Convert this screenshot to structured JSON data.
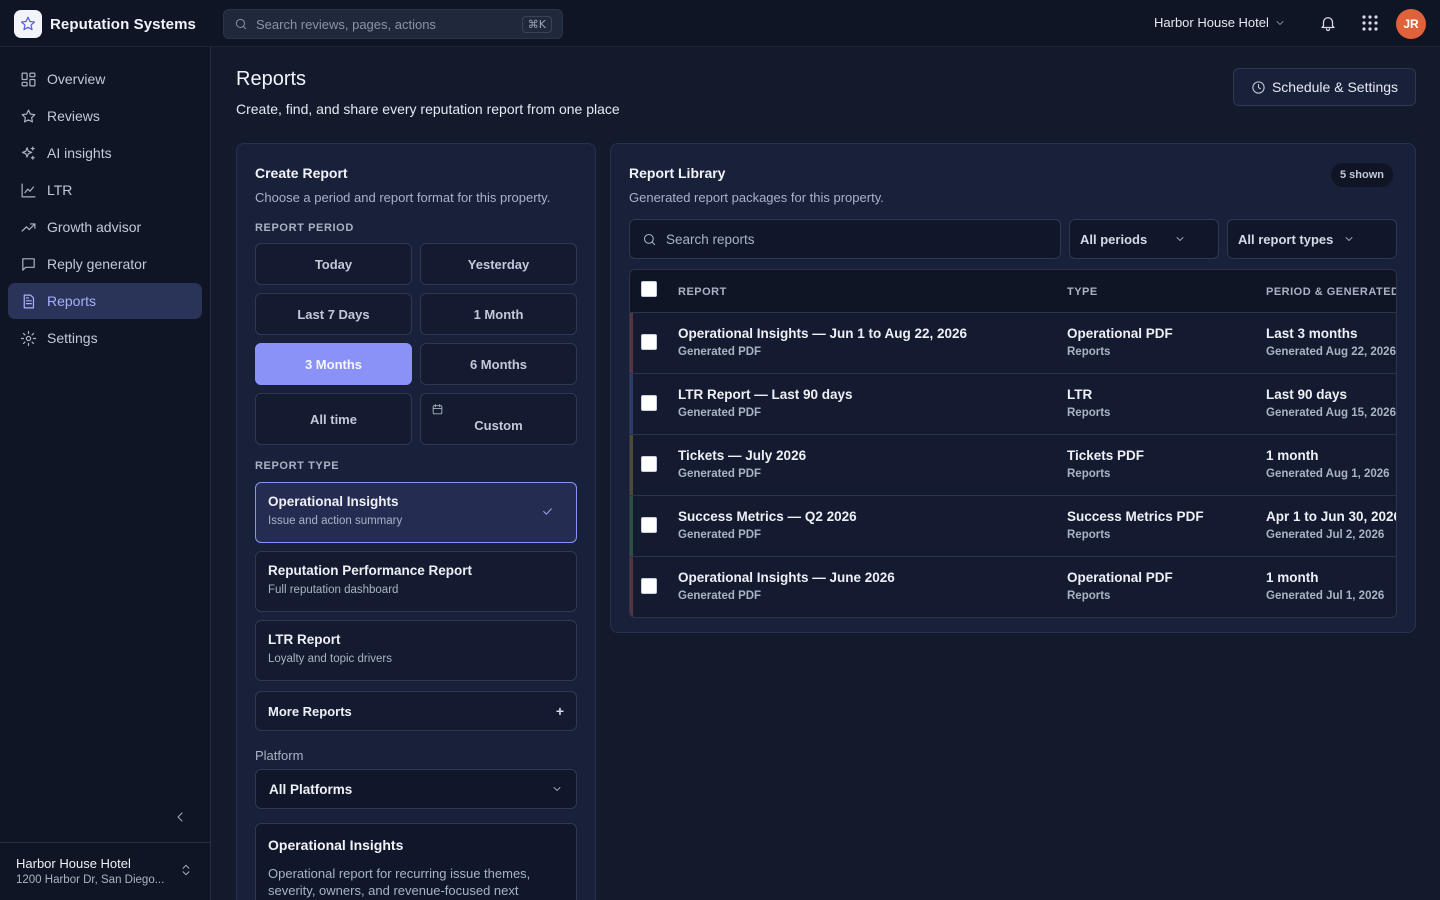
{
  "app": {
    "name": "Reputation Systems"
  },
  "topbar": {
    "search_placeholder": "Search reviews, pages, actions",
    "search_shortcut": "⌘K",
    "property": "Harbor House Hotel",
    "avatar_initials": "JR"
  },
  "sidebar": {
    "items": [
      {
        "label": "Overview",
        "icon": "grid-icon"
      },
      {
        "label": "Reviews",
        "icon": "star-icon"
      },
      {
        "label": "AI insights",
        "icon": "sparkles-icon"
      },
      {
        "label": "LTR",
        "icon": "line-chart-icon"
      },
      {
        "label": "Growth advisor",
        "icon": "trend-up-icon"
      },
      {
        "label": "Reply generator",
        "icon": "chat-icon"
      },
      {
        "label": "Reports",
        "icon": "document-icon",
        "active": true
      },
      {
        "label": "Settings",
        "icon": "gear-icon"
      }
    ],
    "footer": {
      "name": "Harbor House Hotel",
      "address": "1200 Harbor Dr, San Diego..."
    }
  },
  "header": {
    "title": "Reports",
    "subtitle": "Create, find, and share every reputation report from one place",
    "schedule_button": "Schedule & Settings"
  },
  "create": {
    "title": "Create Report",
    "subtitle": "Choose a period and report format for this property.",
    "period_label": "REPORT PERIOD",
    "periods": [
      "Today",
      "Yesterday",
      "Last 7 Days",
      "1 Month",
      "3 Months",
      "6 Months",
      "All time",
      "Custom"
    ],
    "selected_period": "3 Months",
    "type_label": "REPORT TYPE",
    "types": [
      {
        "name": "Operational Insights",
        "desc": "Issue and action summary",
        "selected": true
      },
      {
        "name": "Reputation Performance Report",
        "desc": "Full reputation dashboard"
      },
      {
        "name": "LTR Report",
        "desc": "Loyalty and topic drivers"
      }
    ],
    "more_reports": "More Reports",
    "more_reports_icon": "+",
    "platform_label": "Platform",
    "platform_value": "All Platforms",
    "summary": {
      "title": "Operational Insights",
      "body": "Operational report for recurring issue themes, severity, owners, and revenue-focused next"
    }
  },
  "library": {
    "title": "Report Library",
    "subtitle": "Generated report packages for this property.",
    "count": "5 shown",
    "search_placeholder": "Search reports",
    "filter_periods": "All periods",
    "filter_types": "All report types",
    "columns": [
      "REPORT",
      "TYPE",
      "PERIOD & GENERATED"
    ],
    "rows": [
      {
        "name": "Operational Insights — Jun 1 to Aug 22, 2026",
        "format": "Generated PDF",
        "type": "Operational PDF",
        "category": "Reports",
        "period": "Last 3 months",
        "generated": "Generated Aug 22, 2026",
        "accent": "#5a3342"
      },
      {
        "name": "LTR Report — Last 90 days",
        "format": "Generated PDF",
        "type": "LTR",
        "category": "Reports",
        "period": "Last 90 days",
        "generated": "Generated Aug 15, 2026",
        "accent": "#2b3d6e"
      },
      {
        "name": "Tickets — July 2026",
        "format": "Generated PDF",
        "type": "Tickets PDF",
        "category": "Reports",
        "period": "1 month",
        "generated": "Generated Aug 1, 2026",
        "accent": "#4f4a33"
      },
      {
        "name": "Success Metrics — Q2 2026",
        "format": "Generated PDF",
        "type": "Success Metrics PDF",
        "category": "Reports",
        "period": "Apr 1 to Jun 30, 2026",
        "generated": "Generated Jul 2, 2026",
        "accent": "#2d4f44"
      },
      {
        "name": "Operational Insights — June 2026",
        "format": "Generated PDF",
        "type": "Operational PDF",
        "category": "Reports",
        "period": "1 month",
        "generated": "Generated Jul 1, 2026",
        "accent": "#5a3342"
      }
    ]
  }
}
